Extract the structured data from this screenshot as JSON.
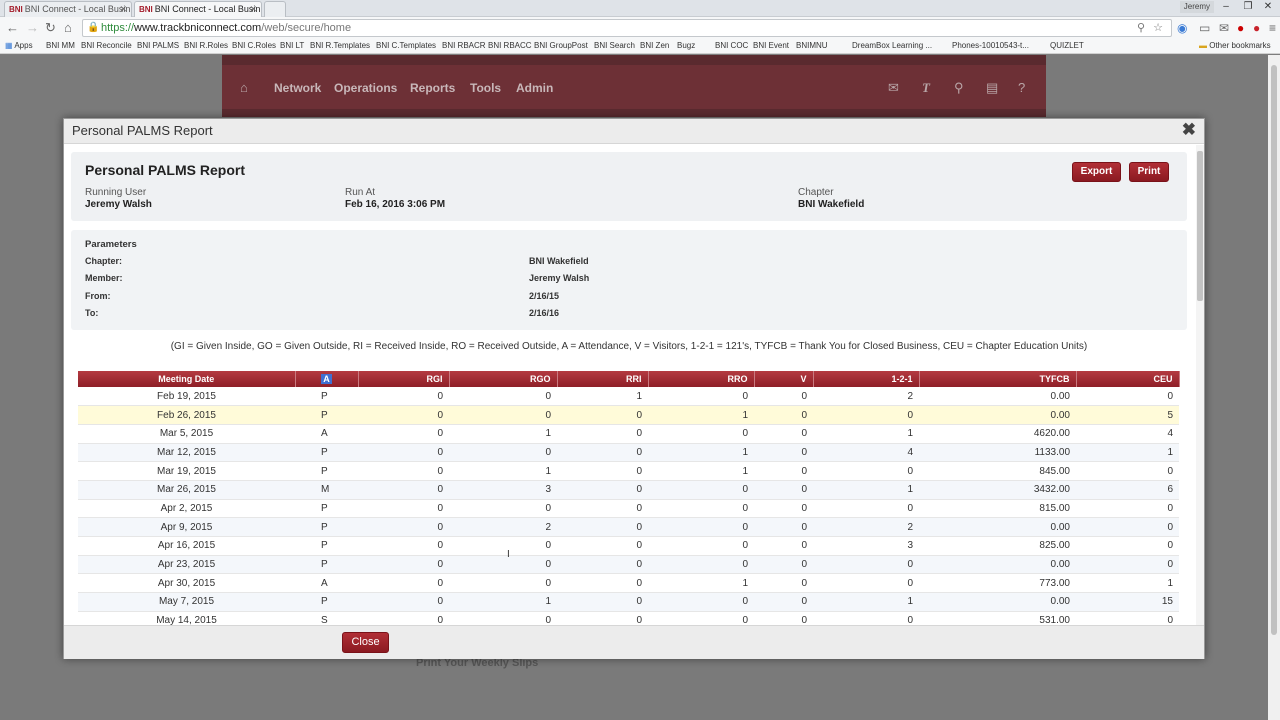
{
  "browser": {
    "tabs": [
      {
        "label": "BNI Connect - Local Busin",
        "active": false
      },
      {
        "label": "BNI Connect - Local Busin",
        "active": true
      }
    ],
    "tab_icon_text": "BNI",
    "profile_name": "Jeremy",
    "url_scheme": "https://",
    "url_host": "www.trackbniconnect.com",
    "url_path": "/web/secure/home",
    "bookmarks": [
      "Apps",
      "BNI MM",
      "BNI Reconcile",
      "BNI PALMS",
      "BNI R.Roles",
      "BNI C.Roles",
      "BNI LT",
      "BNI R.Templates",
      "BNI C.Templates",
      "BNI RBACR",
      "BNI RBACC",
      "BNI GroupPost",
      "BNI Search",
      "BNI Zen",
      "Bugz",
      "BNI COC",
      "BNI Event",
      "BNIMNU",
      "DreamBox Learning ...",
      "Phones-10010543-t...",
      "QUIZLET"
    ],
    "other_bookmarks": "Other bookmarks"
  },
  "site": {
    "nav": [
      "Network",
      "Operations",
      "Reports",
      "Tools",
      "Admin"
    ],
    "behind_text": "Print Your Weekly Slips"
  },
  "modal": {
    "title": "Personal PALMS Report",
    "report_title": "Personal PALMS Report",
    "running_user_label": "Running User",
    "running_user": "Jeremy Walsh",
    "run_at_label": "Run At",
    "run_at": "Feb 16, 2016 3:06 PM",
    "chapter_label": "Chapter",
    "chapter": "BNI Wakefield",
    "export_label": "Export",
    "print_label": "Print",
    "close_label": "Close",
    "params_title": "Parameters",
    "params": [
      {
        "label": "Chapter:",
        "value": "BNI Wakefield"
      },
      {
        "label": "Member:",
        "value": "Jeremy Walsh"
      },
      {
        "label": "From:",
        "value": "2/16/15"
      },
      {
        "label": "To:",
        "value": "2/16/16"
      }
    ],
    "legend": "(GI = Given Inside, GO = Given Outside, RI = Received Inside, RO = Received Outside, A = Attendance, V = Visitors, 1-2-1 = 121's, TYFCB = Thank You for Closed Business, CEU = Chapter Education Units)",
    "columns": [
      "Meeting Date",
      "A",
      "RGI",
      "RGO",
      "RRI",
      "RRO",
      "V",
      "1-2-1",
      "TYFCB",
      "CEU"
    ],
    "rows": [
      [
        "Feb 19, 2015",
        "P",
        "0",
        "0",
        "1",
        "0",
        "0",
        "2",
        "0.00",
        "0"
      ],
      [
        "Feb 26, 2015",
        "P",
        "0",
        "0",
        "0",
        "1",
        "0",
        "0",
        "0.00",
        "5"
      ],
      [
        "Mar 5, 2015",
        "A",
        "0",
        "1",
        "0",
        "0",
        "0",
        "1",
        "4620.00",
        "4"
      ],
      [
        "Mar 12, 2015",
        "P",
        "0",
        "0",
        "0",
        "1",
        "0",
        "4",
        "1133.00",
        "1"
      ],
      [
        "Mar 19, 2015",
        "P",
        "0",
        "1",
        "0",
        "1",
        "0",
        "0",
        "845.00",
        "0"
      ],
      [
        "Mar 26, 2015",
        "M",
        "0",
        "3",
        "0",
        "0",
        "0",
        "1",
        "3432.00",
        "6"
      ],
      [
        "Apr 2, 2015",
        "P",
        "0",
        "0",
        "0",
        "0",
        "0",
        "0",
        "815.00",
        "0"
      ],
      [
        "Apr 9, 2015",
        "P",
        "0",
        "2",
        "0",
        "0",
        "0",
        "2",
        "0.00",
        "0"
      ],
      [
        "Apr 16, 2015",
        "P",
        "0",
        "0",
        "0",
        "0",
        "0",
        "3",
        "825.00",
        "0"
      ],
      [
        "Apr 23, 2015",
        "P",
        "0",
        "0",
        "0",
        "0",
        "0",
        "0",
        "0.00",
        "0"
      ],
      [
        "Apr 30, 2015",
        "A",
        "0",
        "0",
        "0",
        "1",
        "0",
        "0",
        "773.00",
        "1"
      ],
      [
        "May 7, 2015",
        "P",
        "0",
        "1",
        "0",
        "0",
        "0",
        "1",
        "0.00",
        "15"
      ],
      [
        "May 14, 2015",
        "S",
        "0",
        "0",
        "0",
        "0",
        "0",
        "0",
        "531.00",
        "0"
      ]
    ],
    "highlighted_row": 1
  },
  "colors": {
    "brand": "#8e1f27",
    "header_bg": "#6d3036",
    "highlight_row": "#fffbd9"
  }
}
